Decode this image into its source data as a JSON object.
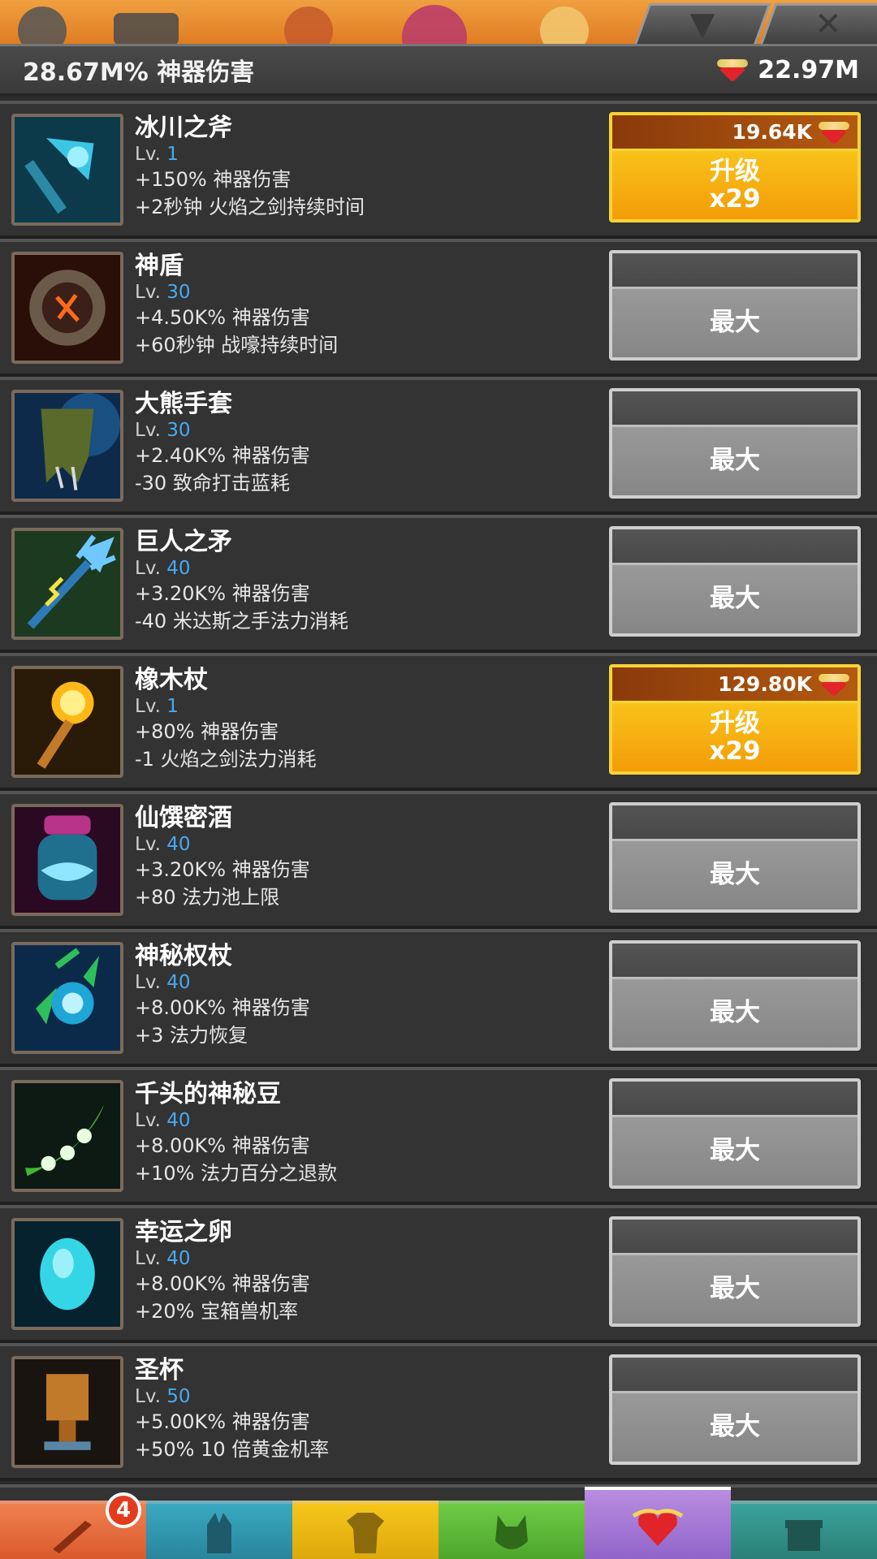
{
  "header": {
    "artifact_damage": "28.67M% 神器伤害",
    "currency_amount": "22.97M",
    "currency_icon": "heart-relic-icon"
  },
  "artifacts": [
    {
      "name": "冰川之斧",
      "lv_prefix": "Lv. ",
      "level": "1",
      "effect1": "+150% 神器伤害",
      "effect2": "+2秒钟 火焰之剑持续时间",
      "button": "upgrade",
      "cost": "19.64K",
      "action": "升级",
      "multiplier": "x29",
      "icon": "axe-icon"
    },
    {
      "name": "神盾",
      "lv_prefix": "Lv. ",
      "level": "30",
      "effect1": "+4.50K% 神器伤害",
      "effect2": "+60秒钟 战嚎持续时间",
      "button": "max",
      "action": "最大",
      "icon": "shield-icon"
    },
    {
      "name": "大熊手套",
      "lv_prefix": "Lv. ",
      "level": "30",
      "effect1": "+2.40K% 神器伤害",
      "effect2": "-30 致命打击蓝耗",
      "button": "max",
      "action": "最大",
      "icon": "bear-glove-icon"
    },
    {
      "name": "巨人之矛",
      "lv_prefix": "Lv. ",
      "level": "40",
      "effect1": "+3.20K% 神器伤害",
      "effect2": "-40 米达斯之手法力消耗",
      "button": "max",
      "action": "最大",
      "icon": "spear-icon"
    },
    {
      "name": "橡木杖",
      "lv_prefix": "Lv. ",
      "level": "1",
      "effect1": "+80% 神器伤害",
      "effect2": "-1 火焰之剑法力消耗",
      "button": "upgrade",
      "cost": "129.80K",
      "action": "升级",
      "multiplier": "x29",
      "icon": "oak-staff-icon"
    },
    {
      "name": "仙馔密酒",
      "lv_prefix": "Lv. ",
      "level": "40",
      "effect1": "+3.20K% 神器伤害",
      "effect2": "+80 法力池上限",
      "button": "max",
      "action": "最大",
      "icon": "nectar-jar-icon"
    },
    {
      "name": "神秘权杖",
      "lv_prefix": "Lv. ",
      "level": "40",
      "effect1": "+8.00K% 神器伤害",
      "effect2": "+3 法力恢复",
      "button": "max",
      "action": "最大",
      "icon": "mystic-staff-icon"
    },
    {
      "name": "千头的神秘豆",
      "lv_prefix": "Lv. ",
      "level": "40",
      "effect1": "+8.00K% 神器伤害",
      "effect2": "+10% 法力百分之退款",
      "button": "max",
      "action": "最大",
      "icon": "bean-pod-icon"
    },
    {
      "name": "幸运之卵",
      "lv_prefix": "Lv. ",
      "level": "40",
      "effect1": "+8.00K% 神器伤害",
      "effect2": "+20% 宝箱兽机率",
      "button": "max",
      "action": "最大",
      "icon": "lucky-egg-icon"
    },
    {
      "name": "圣杯",
      "lv_prefix": "Lv. ",
      "level": "50",
      "effect1": "+5.00K% 神器伤害",
      "effect2": "+50% 10 倍黄金机率",
      "button": "max",
      "action": "最大",
      "icon": "chalice-icon"
    }
  ],
  "nav": {
    "sword_badge": "4"
  },
  "colors": {
    "accent_orange": "#f6a40c",
    "level_blue": "#47a9f0",
    "background": "#2b2b2b"
  }
}
